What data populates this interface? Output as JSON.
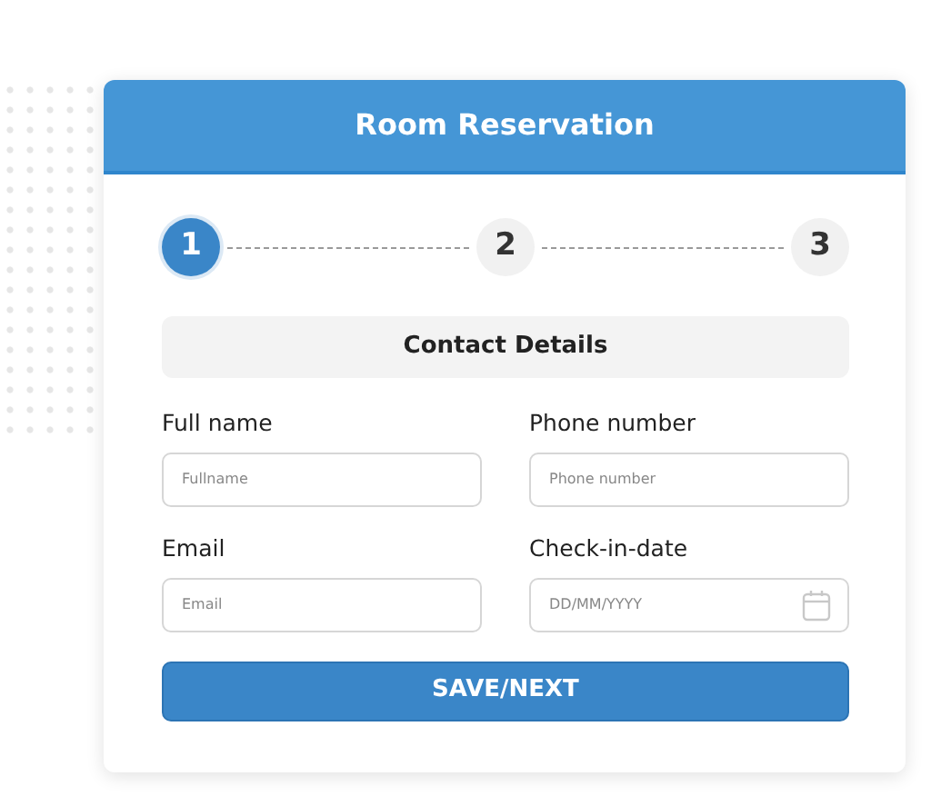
{
  "form": {
    "title": "Room Reservation",
    "steps": [
      {
        "label": "1",
        "selected": true
      },
      {
        "label": "2",
        "selected": false
      },
      {
        "label": "3",
        "selected": false
      }
    ],
    "section": "Contact Details",
    "fields": [
      {
        "kind": "text",
        "label": "Full name",
        "placeholder": "Fullname"
      },
      {
        "kind": "text",
        "label": "Phone number",
        "placeholder": "Phone number"
      },
      {
        "kind": "text",
        "label": "Email",
        "placeholder": "Email"
      },
      {
        "kind": "date",
        "label": "Check-in-date",
        "placeholder": "DD/MM/YYYY"
      }
    ],
    "button": "SAVE/NEXT"
  }
}
